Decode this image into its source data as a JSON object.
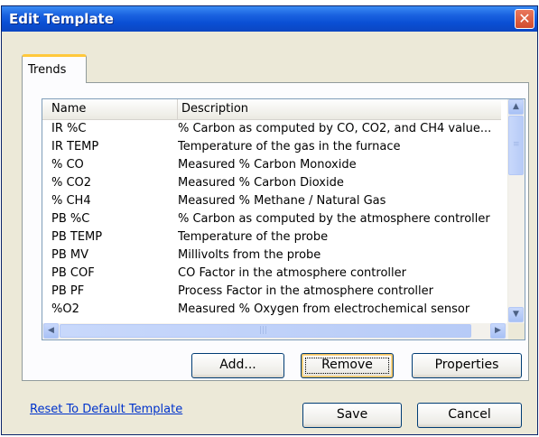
{
  "window": {
    "title": "Edit Template",
    "close_glyph": "✕"
  },
  "tabs": [
    {
      "label": "Trends",
      "selected": true
    }
  ],
  "list": {
    "columns": [
      "Name",
      "Description"
    ],
    "rows": [
      {
        "name": "IR %C",
        "description": "% Carbon as computed by CO, CO2, and CH4 value..."
      },
      {
        "name": "IR TEMP",
        "description": "Temperature of the gas in the furnace"
      },
      {
        "name": "% CO",
        "description": "Measured % Carbon Monoxide"
      },
      {
        "name": "% CO2",
        "description": "Measured % Carbon Dioxide"
      },
      {
        "name": "% CH4",
        "description": "Measured % Methane / Natural Gas"
      },
      {
        "name": "PB %C",
        "description": "% Carbon as computed by the atmosphere controller"
      },
      {
        "name": "PB TEMP",
        "description": "Temperature of the probe"
      },
      {
        "name": "PB MV",
        "description": "Millivolts from the probe"
      },
      {
        "name": "PB COF",
        "description": "CO Factor in the atmosphere controller"
      },
      {
        "name": "PB PF",
        "description": "Process Factor in the atmosphere controller"
      },
      {
        "name": "%O2",
        "description": "Measured % Oxygen from electrochemical sensor"
      }
    ]
  },
  "buttons": {
    "add": "Add...",
    "remove": "Remove",
    "properties": "Properties",
    "save": "Save",
    "cancel": "Cancel"
  },
  "links": {
    "reset": "Reset To Default Template"
  },
  "scroll": {
    "up_glyph": "▲",
    "down_glyph": "▼",
    "left_glyph": "◀",
    "right_glyph": "▶"
  },
  "colors": {
    "title_bar": "#0a4fd4",
    "close_button": "#d24b2d",
    "tab_highlight": "#ffc83c",
    "link": "#0033cc"
  }
}
